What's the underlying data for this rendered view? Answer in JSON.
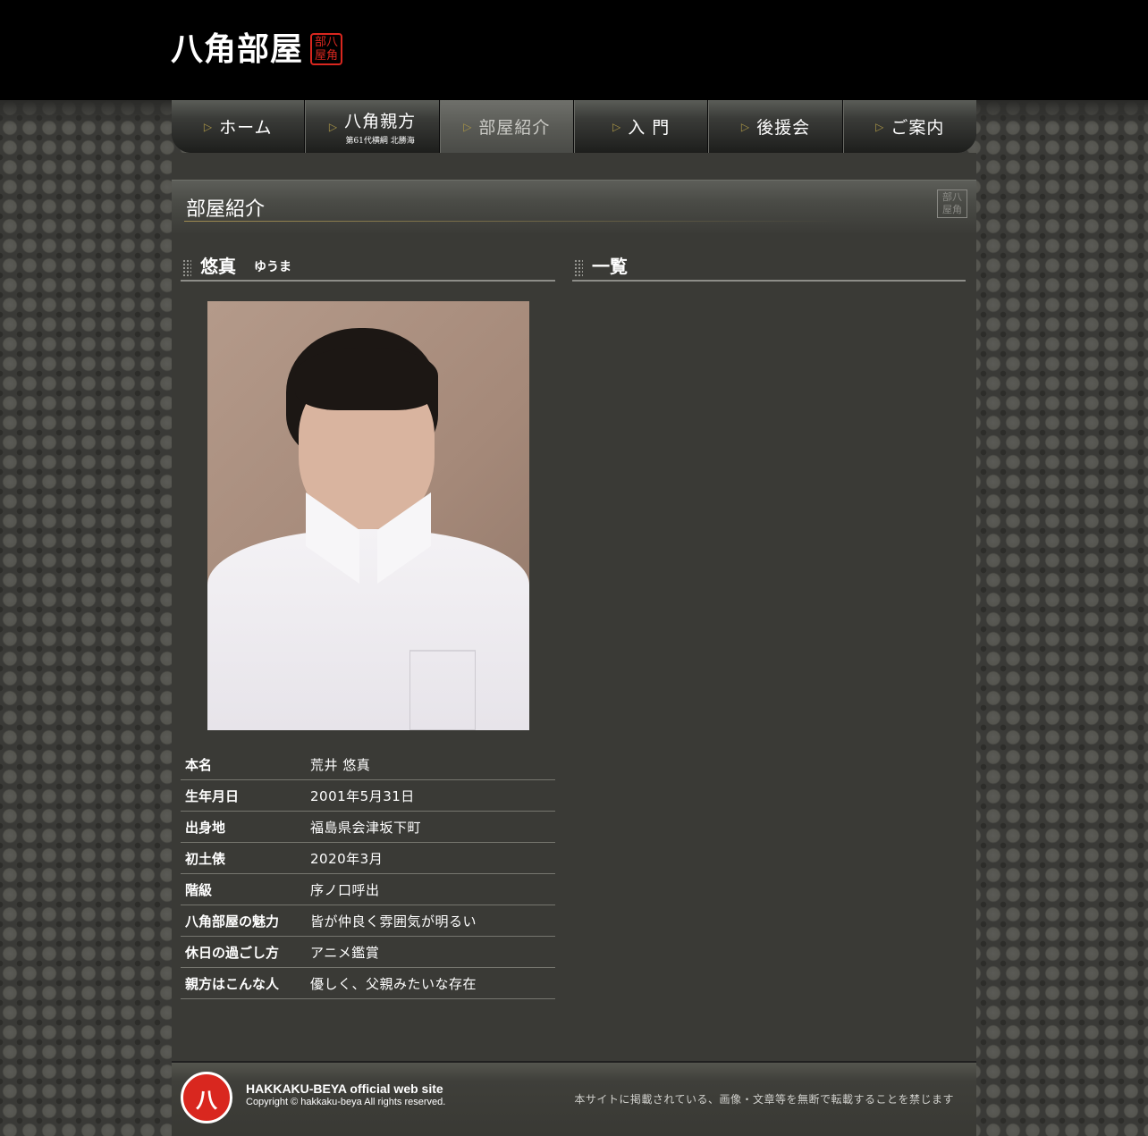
{
  "header": {
    "logo_text": "八角部屋",
    "seal_text": "部八屋角"
  },
  "nav": {
    "items": [
      {
        "label": "ホーム"
      },
      {
        "label": "八角親方",
        "sub": "第61代横綱 北勝海"
      },
      {
        "label": "部屋紹介",
        "active": true
      },
      {
        "label": "入 門"
      },
      {
        "label": "後援会"
      },
      {
        "label": "ご案内"
      }
    ]
  },
  "page": {
    "title": "部屋紹介",
    "seal_text": "部八屋角"
  },
  "profile": {
    "name": "悠真",
    "kana": "ゆうま",
    "rows": [
      {
        "key": "本名",
        "value": "荒井 悠真"
      },
      {
        "key": "生年月日",
        "value": "2001年5月31日"
      },
      {
        "key": "出身地",
        "value": "福島県会津坂下町"
      },
      {
        "key": "初土俵",
        "value": "2020年3月"
      },
      {
        "key": "階級",
        "value": "序ノ口呼出"
      },
      {
        "key": "八角部屋の魅力",
        "value": "皆が仲良く雰囲気が明るい"
      },
      {
        "key": "休日の過ごし方",
        "value": "アニメ鑑賞"
      },
      {
        "key": "親方はこんな人",
        "value": "優しく、父親みたいな存在"
      }
    ]
  },
  "list_section": {
    "title": "一覧"
  },
  "footer": {
    "site_name": "HAKKAKU-BEYA official web site",
    "copyright": "Copyright © hakkaku-beya All rights reserved.",
    "notice": "本サイトに掲載されている、画像・文章等を無断で転載することを禁じます"
  },
  "colors": {
    "accent_red": "#d9271f",
    "gold_line": "#a08c52"
  }
}
